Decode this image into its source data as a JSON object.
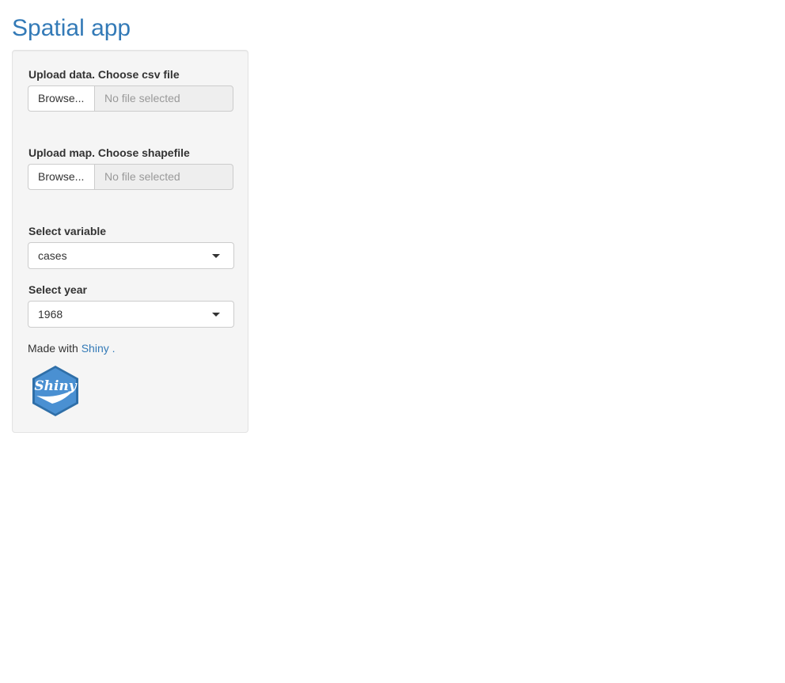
{
  "app": {
    "title": "Spatial app"
  },
  "sidebar": {
    "upload_data": {
      "label": "Upload data. Choose csv file",
      "button_label": "Browse...",
      "placeholder": "No file selected"
    },
    "upload_map": {
      "label": "Upload map. Choose shapefile",
      "button_label": "Browse...",
      "placeholder": "No file selected"
    },
    "select_variable": {
      "label": "Select variable",
      "value": "cases"
    },
    "select_year": {
      "label": "Select year",
      "value": "1968"
    },
    "footer": {
      "prefix": "Made with",
      "link_text": "Shiny",
      "suffix": " ."
    },
    "logo_text": "Shiny"
  },
  "colors": {
    "accent": "#337ab7",
    "logo_blue": "#3e87c8",
    "panel_bg": "#f5f5f5"
  }
}
